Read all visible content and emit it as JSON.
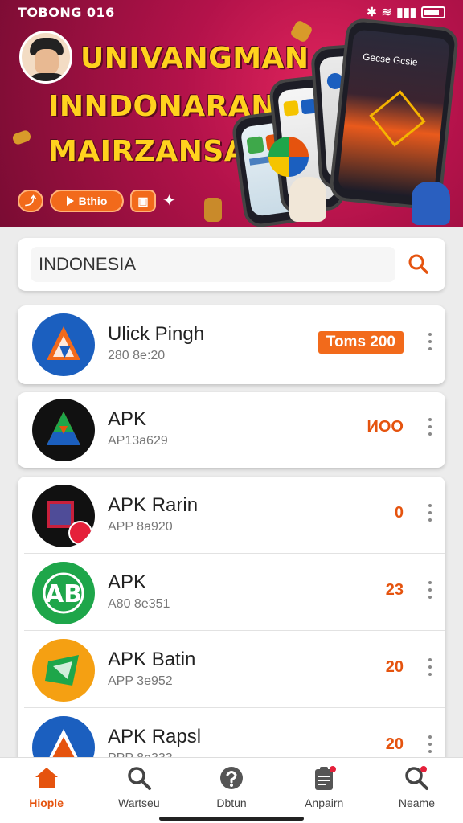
{
  "status_bar": {
    "time": "TOBONG 016"
  },
  "banner": {
    "headline_lines": [
      "UNIVANGMAN",
      "INNDONARAN",
      "MAIRZANSA!"
    ],
    "pill_button_label": "Bthio",
    "screen_title": "Gecse Gcsie"
  },
  "search": {
    "value": "INDONESIA"
  },
  "apps": [
    {
      "name": "Ulick Pingh",
      "subtitle": "280 8e:20",
      "value": "Toms 200",
      "value_style": "badge",
      "icon_color": "#1b5fbf"
    },
    {
      "name": "APK",
      "subtitle": "AP13a629",
      "value": "ИОО",
      "value_style": "text",
      "icon_color": "#111111"
    },
    {
      "name": "APK Rarin",
      "subtitle": "APP 8a920",
      "value": "0",
      "value_style": "text",
      "icon_color": "#111111"
    },
    {
      "name": "APK",
      "subtitle": "A80 8e351",
      "value": "23",
      "value_style": "text",
      "icon_color": "#1ea64a"
    },
    {
      "name": "APK Batin",
      "subtitle": "APP 3e952",
      "value": "20",
      "value_style": "text",
      "icon_color": "#f5a012"
    },
    {
      "name": "APK Rapsl",
      "subtitle": "PPP 8e333",
      "value": "20",
      "value_style": "text",
      "icon_color": "#1b5fbf"
    }
  ],
  "nav": [
    {
      "label": "Hiople",
      "icon": "home-icon",
      "active": true
    },
    {
      "label": "Wartseu",
      "icon": "search-icon",
      "active": false
    },
    {
      "label": "Dbtun",
      "icon": "help-icon",
      "active": false
    },
    {
      "label": "Anpairn",
      "icon": "clipboard-icon",
      "active": false
    },
    {
      "label": "Neame",
      "icon": "search-alert-icon",
      "active": false
    }
  ],
  "colors": {
    "accent": "#f26a1b",
    "banner": "#b3124a"
  }
}
